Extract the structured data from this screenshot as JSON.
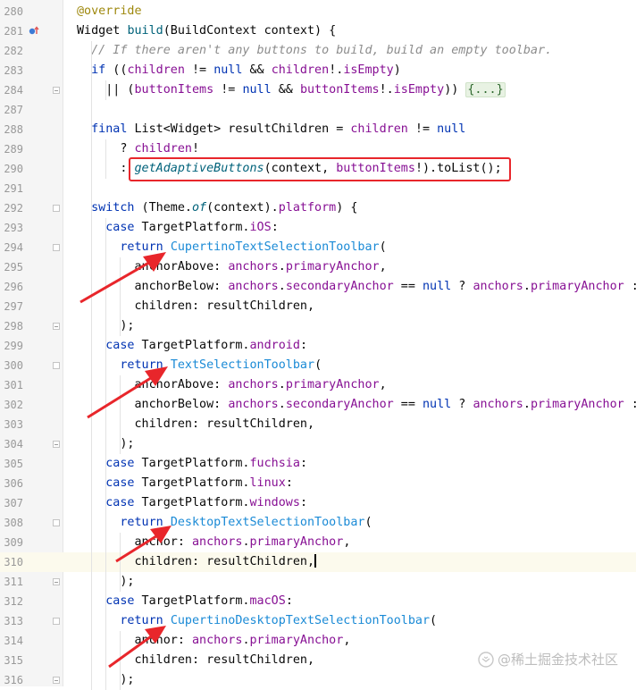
{
  "editor": {
    "lines": [
      {
        "num": "280",
        "tokens": [
          {
            "t": "@override",
            "c": "an"
          }
        ]
      },
      {
        "num": "281",
        "tokens": [
          {
            "t": "Widget ",
            "c": ""
          },
          {
            "t": "build",
            "c": "fn"
          },
          {
            "t": "(BuildContext context) {",
            "c": ""
          }
        ]
      },
      {
        "num": "282",
        "tokens": [
          {
            "t": "  // If there aren't any buttons to build, build an empty toolbar.",
            "c": "cm"
          }
        ]
      },
      {
        "num": "283",
        "tokens": [
          {
            "t": "  ",
            "c": ""
          },
          {
            "t": "if",
            "c": "kw"
          },
          {
            "t": " ((",
            "c": ""
          },
          {
            "t": "children",
            "c": "fld"
          },
          {
            "t": " != ",
            "c": ""
          },
          {
            "t": "null",
            "c": "kw"
          },
          {
            "t": " && ",
            "c": ""
          },
          {
            "t": "children",
            "c": "fld"
          },
          {
            "t": "!.",
            "c": ""
          },
          {
            "t": "isEmpty",
            "c": "fld"
          },
          {
            "t": ")",
            "c": ""
          }
        ]
      },
      {
        "num": "284",
        "tokens": [
          {
            "t": "    || (",
            "c": ""
          },
          {
            "t": "buttonItems",
            "c": "fld"
          },
          {
            "t": " != ",
            "c": ""
          },
          {
            "t": "null",
            "c": "kw"
          },
          {
            "t": " && ",
            "c": ""
          },
          {
            "t": "buttonItems",
            "c": "fld"
          },
          {
            "t": "!.",
            "c": ""
          },
          {
            "t": "isEmpty",
            "c": "fld"
          },
          {
            "t": ")) ",
            "c": ""
          },
          {
            "t": "{...}",
            "c": "fold-txt"
          }
        ]
      },
      {
        "num": "287",
        "tokens": []
      },
      {
        "num": "288",
        "tokens": [
          {
            "t": "  ",
            "c": ""
          },
          {
            "t": "final",
            "c": "kw"
          },
          {
            "t": " List<Widget> resultChildren = ",
            "c": ""
          },
          {
            "t": "children",
            "c": "fld"
          },
          {
            "t": " != ",
            "c": ""
          },
          {
            "t": "null",
            "c": "kw"
          }
        ]
      },
      {
        "num": "289",
        "tokens": [
          {
            "t": "      ? ",
            "c": ""
          },
          {
            "t": "children",
            "c": "fld"
          },
          {
            "t": "!",
            "c": ""
          }
        ]
      },
      {
        "num": "290",
        "tokens": [
          {
            "t": "      : ",
            "c": ""
          },
          {
            "t": "getAdaptiveButtons",
            "c": "fn it"
          },
          {
            "t": "(context, ",
            "c": ""
          },
          {
            "t": "buttonItems",
            "c": "fld"
          },
          {
            "t": "!).toList();",
            "c": ""
          }
        ]
      },
      {
        "num": "291",
        "tokens": []
      },
      {
        "num": "292",
        "tokens": [
          {
            "t": "  ",
            "c": ""
          },
          {
            "t": "switch",
            "c": "kw"
          },
          {
            "t": " (Theme.",
            "c": ""
          },
          {
            "t": "of",
            "c": "fn it"
          },
          {
            "t": "(context).",
            "c": ""
          },
          {
            "t": "platform",
            "c": "fld"
          },
          {
            "t": ") {",
            "c": ""
          }
        ]
      },
      {
        "num": "293",
        "tokens": [
          {
            "t": "    ",
            "c": ""
          },
          {
            "t": "case",
            "c": "kw"
          },
          {
            "t": " TargetPlatform.",
            "c": ""
          },
          {
            "t": "iOS",
            "c": "fld"
          },
          {
            "t": ":",
            "c": ""
          }
        ]
      },
      {
        "num": "294",
        "tokens": [
          {
            "t": "      ",
            "c": ""
          },
          {
            "t": "return",
            "c": "kw"
          },
          {
            "t": " ",
            "c": ""
          },
          {
            "t": "CupertinoTextSelectionToolbar",
            "c": "cls"
          },
          {
            "t": "(",
            "c": ""
          }
        ]
      },
      {
        "num": "295",
        "tokens": [
          {
            "t": "        anchorAbove: ",
            "c": ""
          },
          {
            "t": "anchors",
            "c": "fld"
          },
          {
            "t": ".",
            "c": ""
          },
          {
            "t": "primaryAnchor",
            "c": "fld"
          },
          {
            "t": ",",
            "c": ""
          }
        ]
      },
      {
        "num": "296",
        "tokens": [
          {
            "t": "        anchorBelow: ",
            "c": ""
          },
          {
            "t": "anchors",
            "c": "fld"
          },
          {
            "t": ".",
            "c": ""
          },
          {
            "t": "secondaryAnchor",
            "c": "fld"
          },
          {
            "t": " == ",
            "c": ""
          },
          {
            "t": "null",
            "c": "kw"
          },
          {
            "t": " ? ",
            "c": ""
          },
          {
            "t": "anchors",
            "c": "fld"
          },
          {
            "t": ".",
            "c": ""
          },
          {
            "t": "primaryAnchor",
            "c": "fld"
          },
          {
            "t": " :",
            "c": ""
          }
        ]
      },
      {
        "num": "297",
        "tokens": [
          {
            "t": "        children: resultChildren,",
            "c": ""
          }
        ]
      },
      {
        "num": "298",
        "tokens": [
          {
            "t": "      );",
            "c": ""
          }
        ]
      },
      {
        "num": "299",
        "tokens": [
          {
            "t": "    ",
            "c": ""
          },
          {
            "t": "case",
            "c": "kw"
          },
          {
            "t": " TargetPlatform.",
            "c": ""
          },
          {
            "t": "android",
            "c": "fld"
          },
          {
            "t": ":",
            "c": ""
          }
        ]
      },
      {
        "num": "300",
        "tokens": [
          {
            "t": "      ",
            "c": ""
          },
          {
            "t": "return",
            "c": "kw"
          },
          {
            "t": " ",
            "c": ""
          },
          {
            "t": "TextSelectionToolbar",
            "c": "cls"
          },
          {
            "t": "(",
            "c": ""
          }
        ]
      },
      {
        "num": "301",
        "tokens": [
          {
            "t": "        anchorAbove: ",
            "c": ""
          },
          {
            "t": "anchors",
            "c": "fld"
          },
          {
            "t": ".",
            "c": ""
          },
          {
            "t": "primaryAnchor",
            "c": "fld"
          },
          {
            "t": ",",
            "c": ""
          }
        ]
      },
      {
        "num": "302",
        "tokens": [
          {
            "t": "        anchorBelow: ",
            "c": ""
          },
          {
            "t": "anchors",
            "c": "fld"
          },
          {
            "t": ".",
            "c": ""
          },
          {
            "t": "secondaryAnchor",
            "c": "fld"
          },
          {
            "t": " == ",
            "c": ""
          },
          {
            "t": "null",
            "c": "kw"
          },
          {
            "t": " ? ",
            "c": ""
          },
          {
            "t": "anchors",
            "c": "fld"
          },
          {
            "t": ".",
            "c": ""
          },
          {
            "t": "primaryAnchor",
            "c": "fld"
          },
          {
            "t": " :",
            "c": ""
          }
        ]
      },
      {
        "num": "303",
        "tokens": [
          {
            "t": "        children: resultChildren,",
            "c": ""
          }
        ]
      },
      {
        "num": "304",
        "tokens": [
          {
            "t": "      );",
            "c": ""
          }
        ]
      },
      {
        "num": "305",
        "tokens": [
          {
            "t": "    ",
            "c": ""
          },
          {
            "t": "case",
            "c": "kw"
          },
          {
            "t": " TargetPlatform.",
            "c": ""
          },
          {
            "t": "fuchsia",
            "c": "fld"
          },
          {
            "t": ":",
            "c": ""
          }
        ]
      },
      {
        "num": "306",
        "tokens": [
          {
            "t": "    ",
            "c": ""
          },
          {
            "t": "case",
            "c": "kw"
          },
          {
            "t": " TargetPlatform.",
            "c": ""
          },
          {
            "t": "linux",
            "c": "fld"
          },
          {
            "t": ":",
            "c": ""
          }
        ]
      },
      {
        "num": "307",
        "tokens": [
          {
            "t": "    ",
            "c": ""
          },
          {
            "t": "case",
            "c": "kw"
          },
          {
            "t": " TargetPlatform.",
            "c": ""
          },
          {
            "t": "windows",
            "c": "fld"
          },
          {
            "t": ":",
            "c": ""
          }
        ]
      },
      {
        "num": "308",
        "tokens": [
          {
            "t": "      ",
            "c": ""
          },
          {
            "t": "return",
            "c": "kw"
          },
          {
            "t": " ",
            "c": ""
          },
          {
            "t": "DesktopTextSelectionToolbar",
            "c": "cls"
          },
          {
            "t": "(",
            "c": ""
          }
        ]
      },
      {
        "num": "309",
        "tokens": [
          {
            "t": "        anchor: ",
            "c": ""
          },
          {
            "t": "anchors",
            "c": "fld"
          },
          {
            "t": ".",
            "c": ""
          },
          {
            "t": "primaryAnchor",
            "c": "fld"
          },
          {
            "t": ",",
            "c": ""
          }
        ]
      },
      {
        "num": "310",
        "tokens": [
          {
            "t": "        children: resultChildren,",
            "c": ""
          }
        ],
        "caret": true
      },
      {
        "num": "311",
        "tokens": [
          {
            "t": "      );",
            "c": ""
          }
        ]
      },
      {
        "num": "312",
        "tokens": [
          {
            "t": "    ",
            "c": ""
          },
          {
            "t": "case",
            "c": "kw"
          },
          {
            "t": " TargetPlatform.",
            "c": ""
          },
          {
            "t": "macOS",
            "c": "fld"
          },
          {
            "t": ":",
            "c": ""
          }
        ]
      },
      {
        "num": "313",
        "tokens": [
          {
            "t": "      ",
            "c": ""
          },
          {
            "t": "return",
            "c": "kw"
          },
          {
            "t": " ",
            "c": ""
          },
          {
            "t": "CupertinoDesktopTextSelectionToolbar",
            "c": "cls"
          },
          {
            "t": "(",
            "c": ""
          }
        ]
      },
      {
        "num": "314",
        "tokens": [
          {
            "t": "        anchor: ",
            "c": ""
          },
          {
            "t": "anchors",
            "c": "fld"
          },
          {
            "t": ".",
            "c": ""
          },
          {
            "t": "primaryAnchor",
            "c": "fld"
          },
          {
            "t": ",",
            "c": ""
          }
        ]
      },
      {
        "num": "315",
        "tokens": [
          {
            "t": "        children: resultChildren,",
            "c": ""
          }
        ]
      },
      {
        "num": "316",
        "tokens": [
          {
            "t": "      );",
            "c": ""
          }
        ]
      }
    ]
  },
  "annotations": {
    "highlight_color": "#e8262b",
    "highlight_line": "290",
    "arrow_targets": [
      "294",
      "300",
      "308",
      "313"
    ]
  },
  "watermark": {
    "text": "@稀土掘金技术社区"
  },
  "colors": {
    "keyword": "#0033b3",
    "function": "#00627a",
    "field": "#871094",
    "comment": "#8c8c8c",
    "annotation": "#9e880d",
    "class_ref": "#1a8ad6"
  }
}
